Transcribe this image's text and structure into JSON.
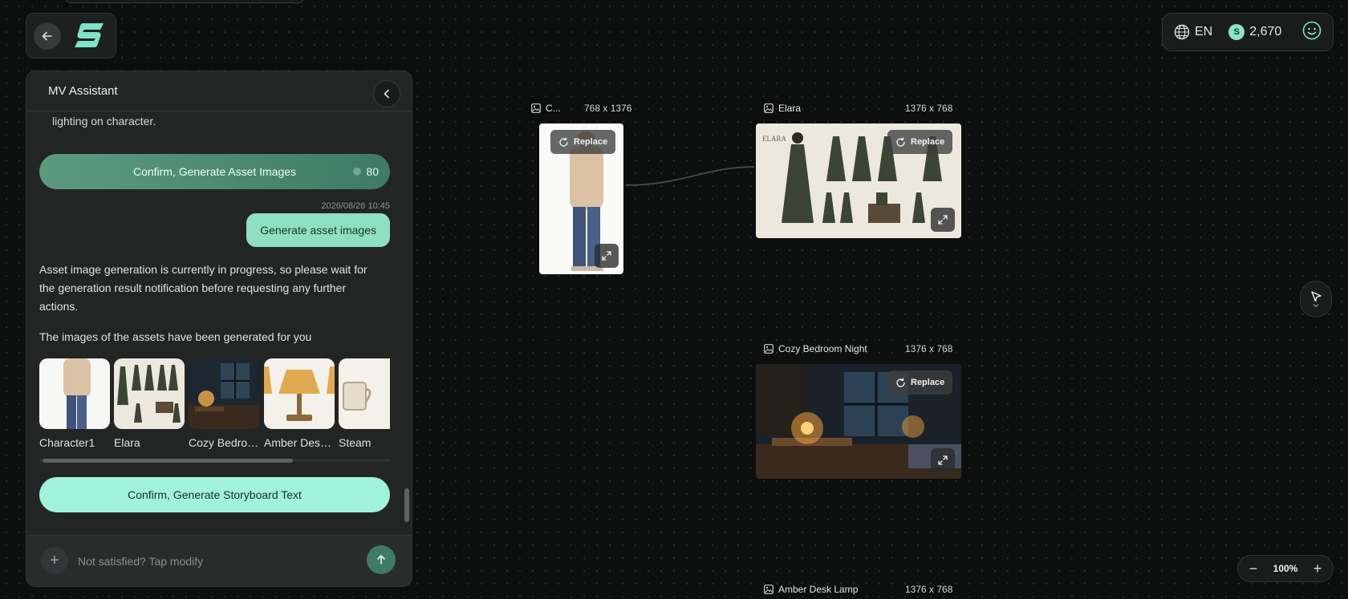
{
  "header": {
    "language": "EN",
    "credits": "2,670",
    "coin_symbol": "S"
  },
  "chat": {
    "title": "MV Assistant",
    "previous_text": "lighting on character.",
    "confirm_assets_label": "Confirm, Generate Asset Images",
    "confirm_assets_cost": "80",
    "timestamp": "2026/08/26 10:45",
    "user_message": "Generate asset images",
    "assistant_message_1": "Asset image generation is currently in progress, so please wait for the generation result notification before requesting any further actions.",
    "assistant_message_2": "The images of the assets have been generated for you",
    "assets": [
      {
        "label": "Character1"
      },
      {
        "label": "Elara"
      },
      {
        "label": "Cozy Bedroom Night"
      },
      {
        "label": "Amber Desk Lamp"
      },
      {
        "label": "Steam"
      }
    ],
    "confirm_storyboard_label": "Confirm, Generate Storyboard Text",
    "input_placeholder": "Not satisfied? Tap modify"
  },
  "canvas": {
    "nodes": [
      {
        "name": "C...",
        "dims": "768 x 1376",
        "replace_label": "Replace"
      },
      {
        "name": "Elara",
        "dims": "1376 x 768",
        "replace_label": "Replace"
      },
      {
        "name": "Cozy Bedroom Night",
        "dims": "1376 x 768",
        "replace_label": "Replace"
      },
      {
        "name": "Amber Desk Lamp",
        "dims": "1376 x 768"
      }
    ],
    "zoom": "100%",
    "zoom_out": "−",
    "zoom_in": "+"
  },
  "colors": {
    "accent": "#8fe0c2",
    "accent_dark": "#3e7b66",
    "background": "#0d0e0e",
    "panel": "#232525"
  }
}
